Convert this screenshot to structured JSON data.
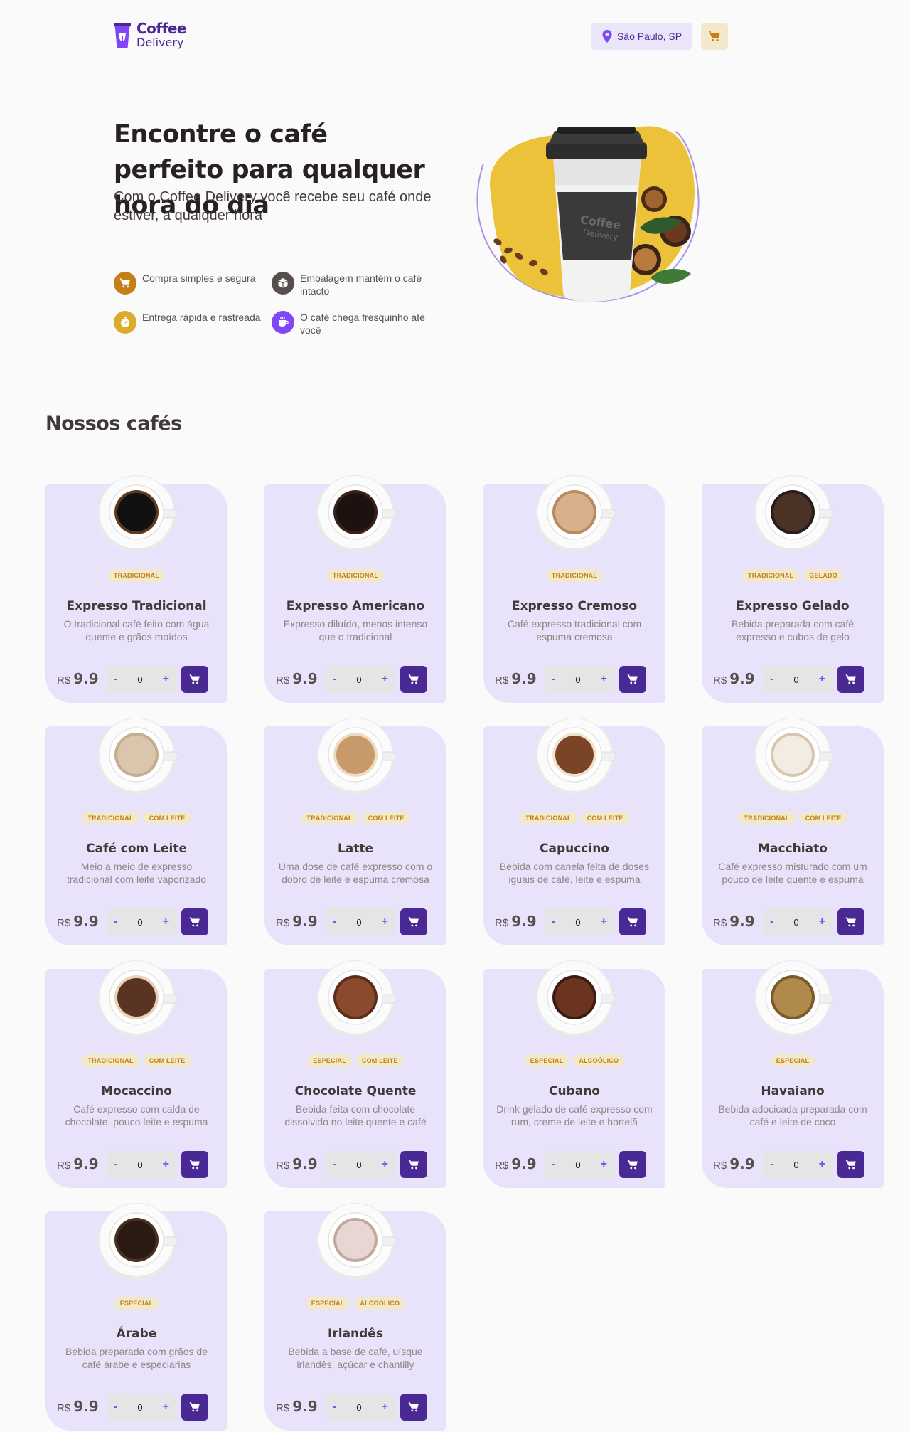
{
  "header": {
    "logo_line1": "Coffee",
    "logo_line2": "Delivery",
    "location": "São Paulo, SP",
    "cart_icon": "shopping-cart-icon"
  },
  "hero": {
    "title": "Encontre o café perfeito para qualquer hora do dia",
    "subtitle": "Com o Coffee Delivery você recebe seu café onde estiver, a qualquer hora",
    "cup_logo_line1": "Coffee",
    "cup_logo_line2": "Delivery",
    "benefits": [
      {
        "label": "Compra simples e segura",
        "icon": "shopping-cart-icon",
        "color": "#c47f17"
      },
      {
        "label": "Embalagem mantém o café intacto",
        "icon": "package-icon",
        "color": "#574f4d"
      },
      {
        "label": "Entrega rápida e rastreada",
        "icon": "timer-icon",
        "color": "#dbac2c"
      },
      {
        "label": "O café chega fresquinho até você",
        "icon": "coffee-icon",
        "color": "#8047f8"
      }
    ]
  },
  "section_title": "Nossos cafés",
  "currency": "R$",
  "products": [
    {
      "name": "Expresso Tradicional",
      "desc": "O tradicional café feito com água quente e grãos moídos",
      "tags": [
        "Tradicional"
      ],
      "price": "9.9",
      "qty": "0"
    },
    {
      "name": "Expresso Americano",
      "desc": "Expresso diluído, menos intenso que o tradicional",
      "tags": [
        "Tradicional"
      ],
      "price": "9.9",
      "qty": "0"
    },
    {
      "name": "Expresso Cremoso",
      "desc": "Café expresso tradicional com espuma cremosa",
      "tags": [
        "Tradicional"
      ],
      "price": "9.9",
      "qty": "0"
    },
    {
      "name": "Expresso Gelado",
      "desc": "Bebida preparada com café expresso e cubos de gelo",
      "tags": [
        "Tradicional",
        "Gelado"
      ],
      "price": "9.9",
      "qty": "0"
    },
    {
      "name": "Café com Leite",
      "desc": "Meio a meio de expresso tradicional com leite vaporizado",
      "tags": [
        "Tradicional",
        "Com leite"
      ],
      "price": "9.9",
      "qty": "0"
    },
    {
      "name": "Latte",
      "desc": "Uma dose de café expresso com o dobro de leite e espuma cremosa",
      "tags": [
        "Tradicional",
        "Com leite"
      ],
      "price": "9.9",
      "qty": "0"
    },
    {
      "name": "Capuccino",
      "desc": "Bebida com canela feita de doses iguais de café, leite e espuma",
      "tags": [
        "Tradicional",
        "Com leite"
      ],
      "price": "9.9",
      "qty": "0"
    },
    {
      "name": "Macchiato",
      "desc": "Café expresso misturado com um pouco de leite quente e espuma",
      "tags": [
        "Tradicional",
        "Com leite"
      ],
      "price": "9.9",
      "qty": "0"
    },
    {
      "name": "Mocaccino",
      "desc": "Café expresso com calda de chocolate, pouco leite e espuma",
      "tags": [
        "Tradicional",
        "Com leite"
      ],
      "price": "9.9",
      "qty": "0"
    },
    {
      "name": "Chocolate Quente",
      "desc": "Bebida feita com chocolate dissolvido no leite quente e café",
      "tags": [
        "Especial",
        "Com leite"
      ],
      "price": "9.9",
      "qty": "0"
    },
    {
      "name": "Cubano",
      "desc": "Drink gelado de café expresso com rum, creme de leite e hortelã",
      "tags": [
        "Especial",
        "Alcoólico"
      ],
      "price": "9.9",
      "qty": "0"
    },
    {
      "name": "Havaiano",
      "desc": "Bebida adocicada preparada com café e leite de coco",
      "tags": [
        "Especial"
      ],
      "price": "9.9",
      "qty": "0"
    },
    {
      "name": "Árabe",
      "desc": "Bebida preparada com grãos de café árabe e especiarias",
      "tags": [
        "Especial"
      ],
      "price": "9.9",
      "qty": "0"
    },
    {
      "name": "Irlandês",
      "desc": "Bebida a base de café, uísque irlandês, açúcar e chantilly",
      "tags": [
        "Especial",
        "Alcoólico"
      ],
      "price": "9.9",
      "qty": "0"
    }
  ],
  "colors": {
    "purple_dark": "#4b2995",
    "purple": "#8047f8",
    "yellow_dark": "#c47f17",
    "yellow": "#dbac2c",
    "card_bg": "#e8e3fa",
    "background": "#fafafa"
  }
}
